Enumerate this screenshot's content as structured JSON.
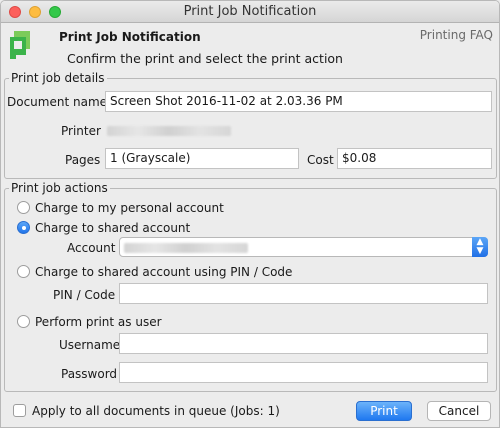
{
  "window": {
    "title": "Print Job Notification"
  },
  "header": {
    "title": "Print Job Notification",
    "subtitle": "Confirm the print and select the print action",
    "faq_link": "Printing FAQ"
  },
  "details": {
    "legend": "Print job details",
    "document_name_label": "Document name",
    "document_name_value": "Screen Shot 2016-11-02 at 2.03.36 PM",
    "printer_label": "Printer",
    "pages_label": "Pages",
    "pages_value": "1   (Grayscale)",
    "cost_label": "Cost",
    "cost_value": "$0.08"
  },
  "actions": {
    "legend": "Print job actions",
    "options": [
      {
        "label": "Charge to my personal account",
        "selected": false
      },
      {
        "label": "Charge to shared account",
        "selected": true
      },
      {
        "label": "Charge to shared account using PIN / Code",
        "selected": false
      },
      {
        "label": "Perform print as user",
        "selected": false
      }
    ],
    "account_label": "Account",
    "pin_label": "PIN / Code",
    "username_label": "Username",
    "password_label": "Password"
  },
  "footer": {
    "apply_all_label": "Apply to all documents in queue (Jobs: 1)",
    "apply_all_checked": false,
    "print_label": "Print",
    "cancel_label": "Cancel"
  },
  "colors": {
    "accent": "#2175eb",
    "logo_green": "#3bb34a"
  }
}
